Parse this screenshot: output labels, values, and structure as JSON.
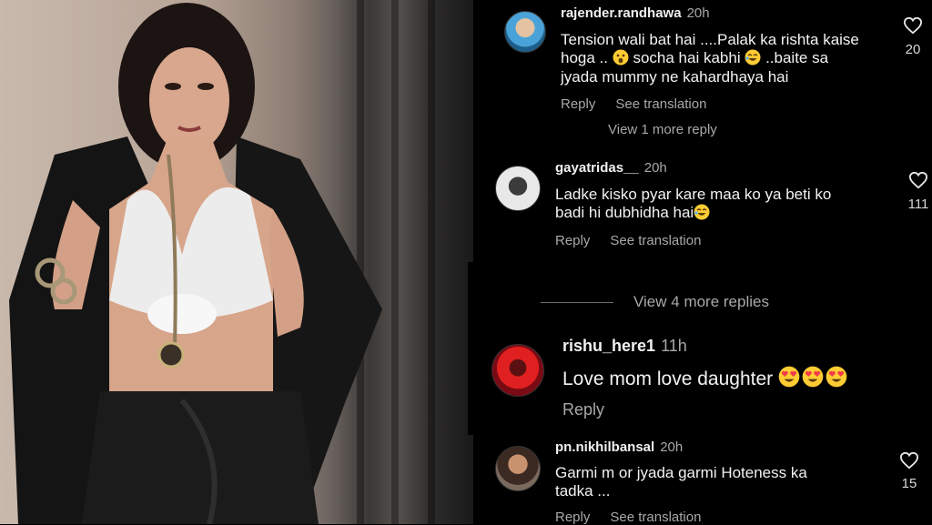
{
  "comments": [
    {
      "username": "rajender.randhawa",
      "time": "20h",
      "text_line1": "Tension wali bat hai ....Palak ka rishta kaise",
      "text_line2_a": "hoga ..",
      "text_line2_b": " socha hai kabhi ",
      "text_line2_c": "..baite sa",
      "text_line3": "jyada mummy ne kahardhaya hai",
      "reply": "Reply",
      "translate": "See translation",
      "likes": "20"
    },
    {
      "username": "gayatridas__",
      "time": "20h",
      "text_line1": "Ladke kisko pyar kare maa ko ya beti ko",
      "text_line2": "badi hi dubhidha hai",
      "reply": "Reply",
      "translate": "See translation",
      "likes": "111"
    },
    {
      "username": "rishu_here1",
      "time": "11h",
      "text": "Love mom love daughter ",
      "reply": "Reply"
    },
    {
      "username": "pn.nikhilbansal",
      "time": "20h",
      "text_line1": "Garmi m or jyada garmi Hoteness ka",
      "text_line2": "tadka ...",
      "reply": "Reply",
      "translate": "See translation",
      "likes": "15"
    }
  ],
  "view_more": [
    {
      "label": "View 1 more reply"
    },
    {
      "label": "View 4 more replies"
    }
  ],
  "colors": {
    "background": "#000000",
    "muted_text": "#a8a8a8",
    "text": "#f2f2f2"
  },
  "icons": [
    "heart-icon",
    "astonished-emoji",
    "laughing-emoji",
    "heart-eyes-emoji"
  ]
}
